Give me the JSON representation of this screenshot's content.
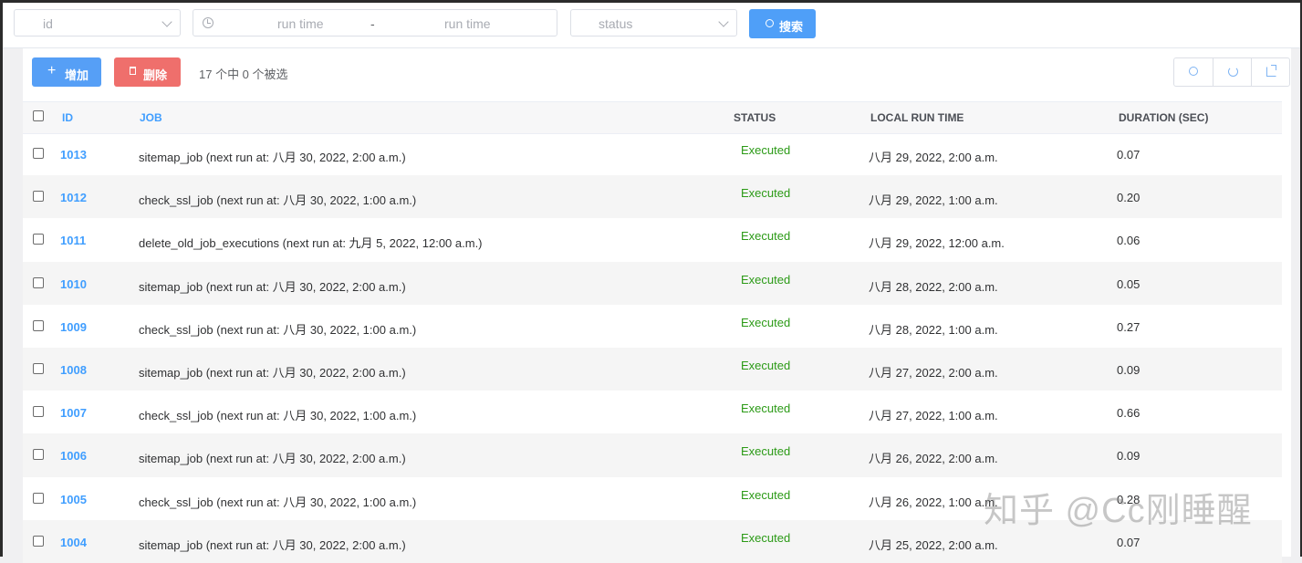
{
  "filters": {
    "id_placeholder": "id",
    "run_time_start_placeholder": "run time",
    "range_separator": "-",
    "run_time_end_placeholder": "run time",
    "status_placeholder": "status",
    "search_label": "搜索"
  },
  "toolbar": {
    "add_label": "增加",
    "delete_label": "删除",
    "selection_info": "17 个中 0 个被选"
  },
  "table": {
    "headers": {
      "id": "ID",
      "job": "JOB",
      "status": "STATUS",
      "local_run_time": "LOCAL RUN TIME",
      "duration": "DURATION (SEC)"
    },
    "rows": [
      {
        "id": "1013",
        "job": "sitemap_job (next run at: 八月 30, 2022, 2:00 a.m.)",
        "status": "Executed",
        "time": "八月 29, 2022, 2:00 a.m.",
        "duration": "0.07"
      },
      {
        "id": "1012",
        "job": "check_ssl_job (next run at: 八月 30, 2022, 1:00 a.m.)",
        "status": "Executed",
        "time": "八月 29, 2022, 1:00 a.m.",
        "duration": "0.20"
      },
      {
        "id": "1011",
        "job": "delete_old_job_executions (next run at: 九月 5, 2022, 12:00 a.m.)",
        "status": "Executed",
        "time": "八月 29, 2022, 12:00 a.m.",
        "duration": "0.06"
      },
      {
        "id": "1010",
        "job": "sitemap_job (next run at: 八月 30, 2022, 2:00 a.m.)",
        "status": "Executed",
        "time": "八月 28, 2022, 2:00 a.m.",
        "duration": "0.05"
      },
      {
        "id": "1009",
        "job": "check_ssl_job (next run at: 八月 30, 2022, 1:00 a.m.)",
        "status": "Executed",
        "time": "八月 28, 2022, 1:00 a.m.",
        "duration": "0.27"
      },
      {
        "id": "1008",
        "job": "sitemap_job (next run at: 八月 30, 2022, 2:00 a.m.)",
        "status": "Executed",
        "time": "八月 27, 2022, 2:00 a.m.",
        "duration": "0.09"
      },
      {
        "id": "1007",
        "job": "check_ssl_job (next run at: 八月 30, 2022, 1:00 a.m.)",
        "status": "Executed",
        "time": "八月 27, 2022, 1:00 a.m.",
        "duration": "0.66"
      },
      {
        "id": "1006",
        "job": "sitemap_job (next run at: 八月 30, 2022, 2:00 a.m.)",
        "status": "Executed",
        "time": "八月 26, 2022, 2:00 a.m.",
        "duration": "0.09"
      },
      {
        "id": "1005",
        "job": "check_ssl_job (next run at: 八月 30, 2022, 1:00 a.m.)",
        "status": "Executed",
        "time": "八月 26, 2022, 1:00 a.m.",
        "duration": "0.28"
      },
      {
        "id": "1004",
        "job": "sitemap_job (next run at: 八月 30, 2022, 2:00 a.m.)",
        "status": "Executed",
        "time": "八月 25, 2022, 2:00 a.m.",
        "duration": "0.07"
      }
    ]
  },
  "watermark": "知乎 @Cc刚睡醒",
  "colors": {
    "primary": "#409eff",
    "danger": "#ef6f6c",
    "success_text": "#2b9a16"
  }
}
